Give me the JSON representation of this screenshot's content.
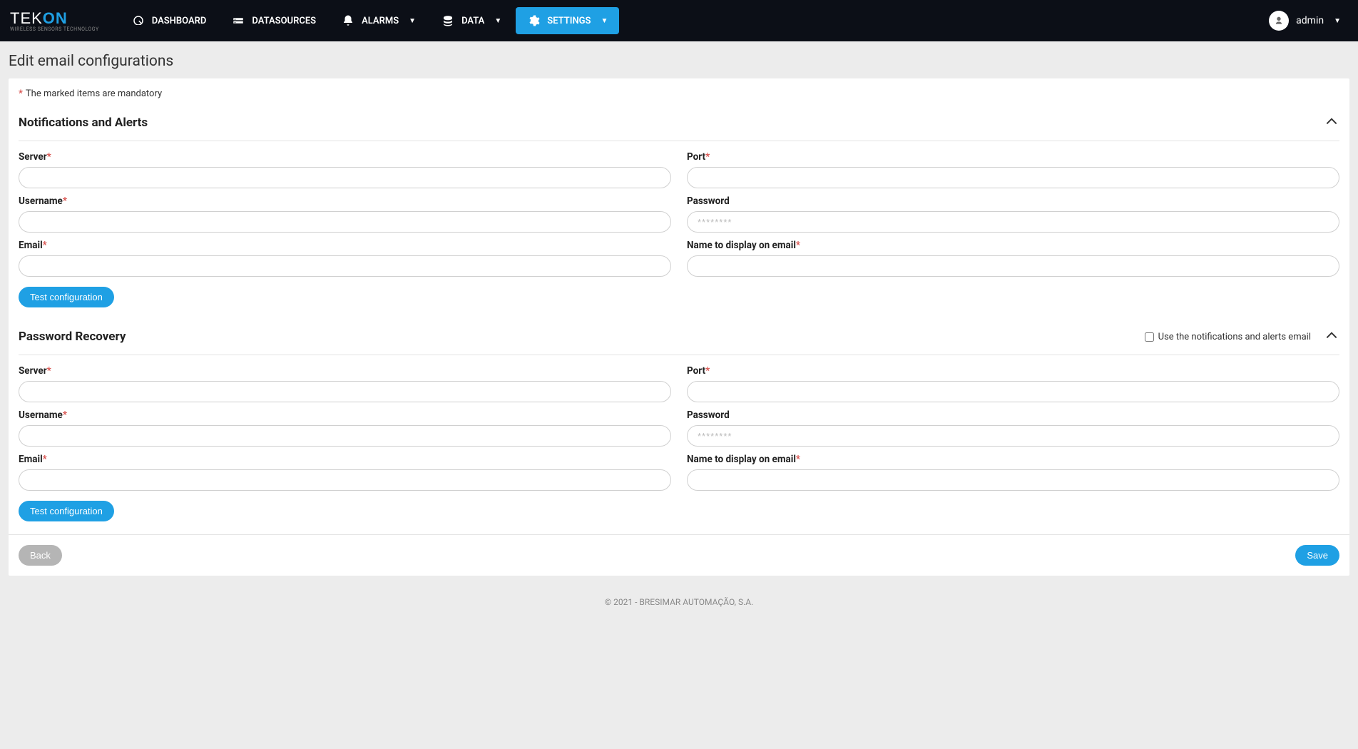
{
  "nav": {
    "logo_main_a": "TEK",
    "logo_main_b": "ON",
    "logo_sub": "WIRELESS SENSORS TECHNOLOGY",
    "items": {
      "dashboard": "DASHBOARD",
      "datasources": "DATASOURCES",
      "alarms": "ALARMS",
      "data": "DATA",
      "settings": "SETTINGS"
    },
    "user": "admin"
  },
  "page": {
    "title": "Edit email configurations",
    "mandatory_note": "The marked items are mandatory"
  },
  "section1": {
    "title": "Notifications and Alerts",
    "fields": {
      "server": "Server",
      "port": "Port",
      "username": "Username",
      "password": "Password",
      "password_placeholder": "********",
      "email": "Email",
      "display_name": "Name to display on email"
    },
    "test_btn": "Test configuration"
  },
  "section2": {
    "title": "Password Recovery",
    "use_same_label": "Use the notifications and alerts email",
    "fields": {
      "server": "Server",
      "port": "Port",
      "username": "Username",
      "password": "Password",
      "password_placeholder": "********",
      "email": "Email",
      "display_name": "Name to display on email"
    },
    "test_btn": "Test configuration"
  },
  "actions": {
    "back": "Back",
    "save": "Save"
  },
  "footer": "© 2021 - BRESIMAR AUTOMAÇÃO, S.A."
}
